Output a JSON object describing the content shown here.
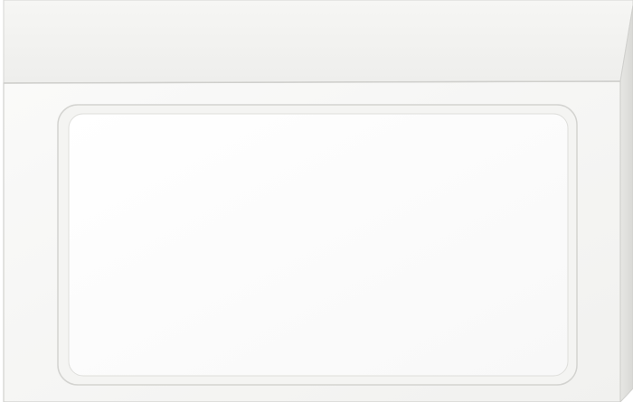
{
  "image": {
    "subject": "square-surface-mounted-led-panel-light",
    "colors": {
      "background": "#ffffff",
      "frame_top": "#f3f3f1",
      "frame_face": "#f7f7f5",
      "frame_shadow": "#d9d9d6",
      "bevel_light": "#fbfbfa",
      "bevel_dark": "#cfcfcc",
      "diffuser": "#fbfbfb"
    }
  }
}
